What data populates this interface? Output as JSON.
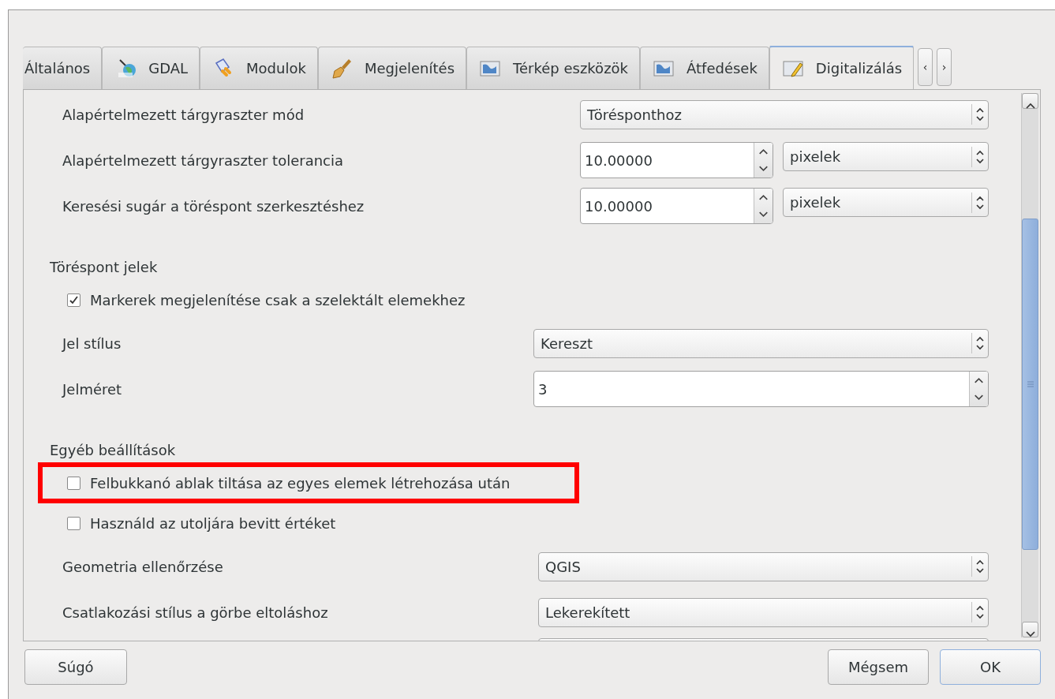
{
  "tabs": [
    {
      "label": "Általános",
      "selected": false
    },
    {
      "label": "GDAL",
      "selected": false
    },
    {
      "label": "Modulok",
      "selected": false
    },
    {
      "label": "Megjelenítés",
      "selected": false
    },
    {
      "label": "Térkép eszközök",
      "selected": false
    },
    {
      "label": "Átfedések",
      "selected": false
    },
    {
      "label": "Digitalizálás",
      "selected": true
    }
  ],
  "tab_scroll_buttons": [
    "‹",
    "›"
  ],
  "sections": [
    {
      "rows": [
        {
          "kind": "combo",
          "label": "Alapértelmezett tárgyraszter mód",
          "value": "Törésponthoz"
        },
        {
          "kind": "spin_combo",
          "label": "Alapértelmezett tárgyraszter tolerancia",
          "value": "10.00000",
          "unit": "pixelek"
        },
        {
          "kind": "spin_combo",
          "label": "Keresési sugár a töréspont szerkesztéshez",
          "value": "10.00000",
          "unit": "pixelek"
        }
      ]
    },
    {
      "heading": "Töréspont jelek",
      "rows": [
        {
          "kind": "checkbox",
          "label": "Markerek megjelenítése csak a szelektált elemekhez",
          "checked": true,
          "highlighted": false
        },
        {
          "kind": "combo",
          "label": "Jel stílus",
          "value": "Kereszt"
        },
        {
          "kind": "spin",
          "label": "Jelméret",
          "value": "3"
        }
      ]
    },
    {
      "heading": "Egyéb beállítások",
      "rows": [
        {
          "kind": "checkbox",
          "label": "Felbukkanó ablak tiltása az egyes elemek létrehozása után",
          "checked": false,
          "highlighted": true
        },
        {
          "kind": "checkbox",
          "label": "Használd az utoljára bevitt értéket",
          "checked": false,
          "highlighted": false
        },
        {
          "kind": "combo",
          "label": "Geometria ellenőrzése",
          "value": "QGIS"
        },
        {
          "kind": "combo",
          "label": "Csatlakozási stílus a görbe eltoláshoz",
          "value": "Lekerekített"
        }
      ]
    }
  ],
  "buttons": [
    {
      "label": "Súgó",
      "default": false
    },
    {
      "label": "Mégsem",
      "default": false
    },
    {
      "label": "OK",
      "default": true
    }
  ]
}
